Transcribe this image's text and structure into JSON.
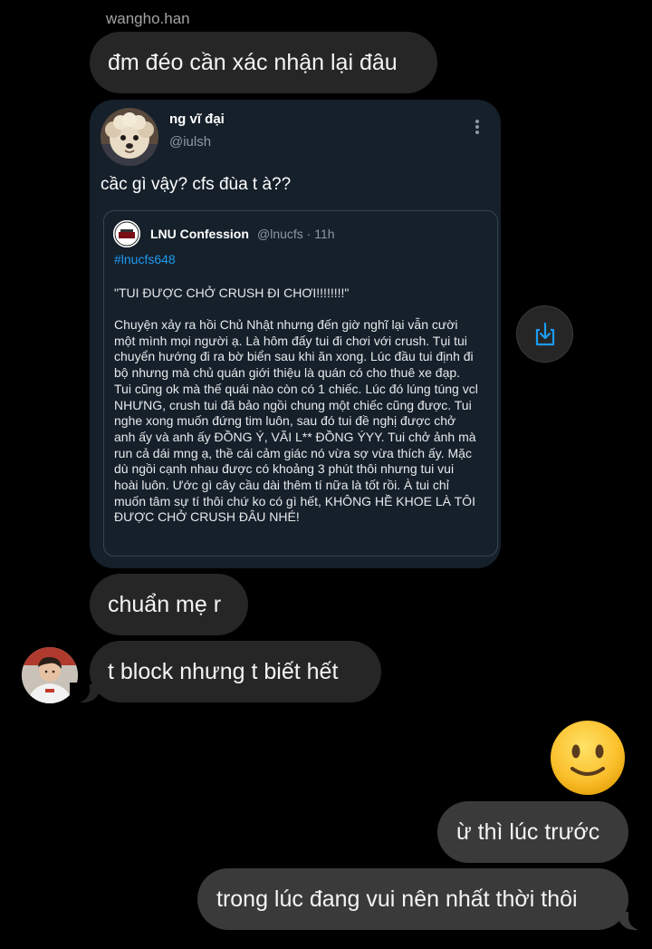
{
  "thread": {
    "sender_name": "wangho.han",
    "messages": {
      "m1": "đm đéo cần xác nhận lại đâu",
      "m2": "chuẩn mẹ r",
      "m3": "t block nhưng t biết hết",
      "m4": "ừ thì lúc trước",
      "m5": "trong lúc đang vui nên nhất thời thôi"
    },
    "reaction_emoji": "slightly-smiling-face"
  },
  "tweet": {
    "author_name": "ng vĩ đại",
    "author_handle": "@iulsh",
    "text": "cầc gì vậy? cfs đùa t à??",
    "quoted": {
      "name": "LNU Confession",
      "handle_time": "@lnucfs · 11h",
      "hashtag": "#lnucfs648",
      "title": "\"TUI ĐƯỢC CHỞ CRUSH ĐI CHƠI!!!!!!!!\"",
      "body": "Chuyện xảy ra hồi Chủ Nhật nhưng đến giờ nghĩ lại vẫn cười một mình mọi người ạ. Là hôm đấy tui đi chơi với crush. Tụi tui chuyển hướng đi ra bờ biển sau khi ăn xong. Lúc đầu tui định đi bộ nhưng mà chủ quán giới thiệu là quán có cho thuê xe đạp. Tui cũng ok mà thế quái nào còn có 1 chiếc. Lúc đó lúng túng vcl NHƯNG, crush tui đã bảo ngồi chung một chiếc cũng được. Tui nghe xong muốn đứng tim luôn, sau đó tui đề nghị được chở anh ấy và anh ấy ĐỒNG Ý, VÃI L** ĐỒNG ÝYY. Tui chở ảnh mà run cả dái mng ạ, thề cái cảm giác nó vừa sợ vừa thích ấy. Mặc dù ngồi cạnh nhau được có khoảng 3 phút thôi nhưng tui vui hoài luôn. Ước gì cây cầu dài thêm tí nữa là tốt rồi. À tui chỉ muốn tâm sự tí thôi chứ ko có gì hết, KHÔNG HỀ KHOE LÀ TÔI ĐƯỢC CHỞ CRUSH ĐÂU NHÉ!"
    }
  },
  "icons": {
    "more": "more-vertical-icon",
    "share": "share-download-icon"
  },
  "colors": {
    "background": "#000000",
    "bubble_incoming": "#262626",
    "bubble_outgoing": "#3a3a3a",
    "tweet_card": "#15202b",
    "hashtag": "#1d9bf0",
    "share_icon": "#1d9bf0"
  }
}
